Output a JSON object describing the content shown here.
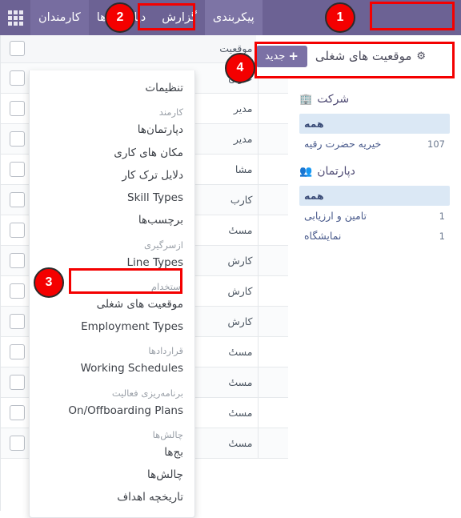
{
  "navbar": {
    "apps_icon": "grid-apps-icon",
    "items": [
      {
        "label": "کارمندان",
        "state": "active"
      },
      {
        "label": "دپارتمان‌ها",
        "state": "normal"
      },
      {
        "label": "گزارش",
        "state": "normal"
      },
      {
        "label": "پیکربندی",
        "state": "menu-open"
      }
    ]
  },
  "control_bar": {
    "new_button": "جدید",
    "new_plus": "+",
    "title": "موقعیت های شغلی",
    "gear_icon": "gear-icon"
  },
  "dropdown": {
    "entries": [
      {
        "type": "item",
        "label": "تنظیمات"
      },
      {
        "type": "section",
        "label": "کارمند"
      },
      {
        "type": "item",
        "label": "دپارتمان‌ها"
      },
      {
        "type": "item",
        "label": "مکان های کاری"
      },
      {
        "type": "item",
        "label": "دلایل ترک کار"
      },
      {
        "type": "item",
        "label": "Skill Types"
      },
      {
        "type": "item",
        "label": "برچسب‌ها"
      },
      {
        "type": "section",
        "label": "ازسرگیری"
      },
      {
        "type": "item",
        "label": "Line Types"
      },
      {
        "type": "section",
        "label": "استخدام"
      },
      {
        "type": "item",
        "label": "موقعیت های شغلی"
      },
      {
        "type": "item",
        "label": "Employment Types"
      },
      {
        "type": "section",
        "label": "قراردادها"
      },
      {
        "type": "item",
        "label": "Working Schedules"
      },
      {
        "type": "section",
        "label": "برنامه‌ریزی فعالیت"
      },
      {
        "type": "item",
        "label": "On/Offboarding Plans"
      },
      {
        "type": "section",
        "label": "چالش‌ها"
      },
      {
        "type": "item",
        "label": "بج‌ها"
      },
      {
        "type": "item",
        "label": "چالش‌ها"
      },
      {
        "type": "item",
        "label": "تاریخچه اهداف"
      }
    ]
  },
  "table": {
    "headers": {
      "checkbox": "",
      "drag": "",
      "name": "موقعیت"
    },
    "rows": [
      {
        "name": "عنوان"
      },
      {
        "name": "مدیر"
      },
      {
        "name": "مدیر"
      },
      {
        "name": "مشا"
      },
      {
        "name": "کارب"
      },
      {
        "name": "مستٔ"
      },
      {
        "name": "کارش"
      },
      {
        "name": "کارش"
      },
      {
        "name": "کارش"
      },
      {
        "name": "مستٔ"
      },
      {
        "name": "مستٔ"
      },
      {
        "name": "مستٔ"
      },
      {
        "name": "مستٔ"
      }
    ]
  },
  "filters": [
    {
      "icon": "building-icon",
      "title": "شرکت",
      "rows": [
        {
          "label": "همه",
          "count": "",
          "all": true
        },
        {
          "label": "خیریه حضرت رقیه",
          "count": "107",
          "all": false
        }
      ]
    },
    {
      "icon": "people-icon",
      "title": "دپارتمان",
      "rows": [
        {
          "label": "همه",
          "count": "",
          "all": true
        },
        {
          "label": "تامین و ارزیابی",
          "count": "1",
          "all": false
        },
        {
          "label": "نمایشگاه",
          "count": "1",
          "all": false
        }
      ]
    }
  ],
  "annotations": {
    "badges": [
      {
        "number": "1"
      },
      {
        "number": "2"
      },
      {
        "number": "3"
      },
      {
        "number": "4"
      }
    ],
    "accent_color": "#f40000"
  }
}
